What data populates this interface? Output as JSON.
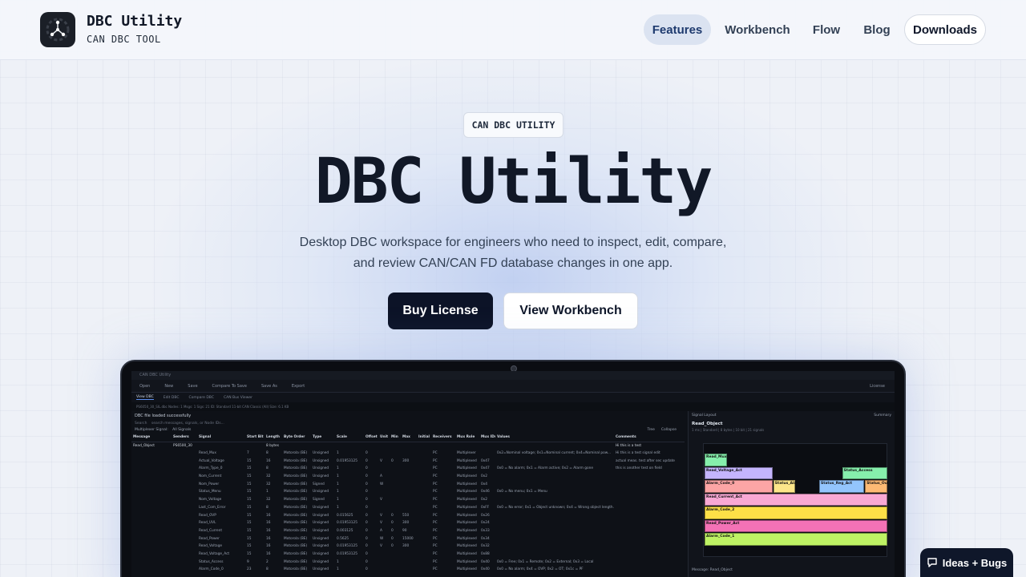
{
  "header": {
    "brand_title": "DBC Utility",
    "brand_subtitle": "CAN DBC TOOL",
    "nav": [
      {
        "label": "Features",
        "active": true
      },
      {
        "label": "Workbench"
      },
      {
        "label": "Flow"
      },
      {
        "label": "Blog"
      },
      {
        "label": "Downloads",
        "outlined": true
      }
    ]
  },
  "hero": {
    "pill": "CAN DBC UTILITY",
    "title": "DBC Utility",
    "description_line1": "Desktop DBC workspace for engineers who need to inspect, edit, compare,",
    "description_line2": "and review CAN/CAN FD database changes in one app.",
    "primary_button": "Buy License",
    "secondary_button": "View Workbench"
  },
  "app": {
    "window_title": "CAN DBC Utility",
    "toolbar": [
      "Open",
      "New",
      "Save",
      "Compare To Save",
      "Save As",
      "Export"
    ],
    "license_label": "License",
    "tabs": [
      "View DBC",
      "Edit DBC",
      "Compare DBC",
      "CAN Bus Viewer"
    ],
    "file_bar": "PS6050_30_SIL.dbc   Nodes: 1   Msgs: 1   Sigs: 21   ID: Standard 11-bit   CAN Classic (All)   Size: 6.1 KB",
    "status": "DBC file loaded successfully",
    "search_label": "Search",
    "search_placeholder": "search messages, signals, or Node IDs...",
    "mux_label": "Multiplexer Signal:",
    "mux_value": "All Signals",
    "tree_label": "Tree",
    "collapse_label": "Collapse",
    "columns": [
      "Message",
      "Senders",
      "Signal",
      "Start Bit",
      "Length",
      "Byte Order",
      "Type",
      "Scale",
      "Offset",
      "Unit",
      "Min",
      "Max",
      "Initial",
      "Receivers",
      "Mux Role",
      "Mux IDs",
      "Values",
      "Comments"
    ],
    "message_row": [
      "Read_Object",
      "PS6500_30",
      "",
      "",
      "8 bytes",
      "",
      "",
      "",
      "",
      "",
      "",
      "",
      "",
      "",
      "",
      "",
      "",
      "Hi this is a test"
    ],
    "rows": [
      [
        "Read_Mux",
        "7",
        "8",
        "Motorola (BE)",
        "Unsigned",
        "1",
        "0",
        "",
        "",
        "",
        "",
        "PC",
        "Multiplexer",
        "",
        "0x2=Nominal voltage; 0x1=Nominal current; 0x4=Nominal pow...",
        "Hi this is a test signal edit"
      ],
      [
        "Actual_Voltage",
        "15",
        "16",
        "Motorola (BE)",
        "Unsigned",
        "0.01953125",
        "0",
        "V",
        "0",
        "300",
        "",
        "PC",
        "Multiplexed",
        "0x47",
        "",
        "actual meas. test after sec update"
      ],
      [
        "Alarm_Type_0",
        "15",
        "8",
        "Motorola (BE)",
        "Unsigned",
        "1",
        "0",
        "",
        "",
        "",
        "",
        "PC",
        "Multiplexed",
        "0x47",
        "0x0 = No alarm; 0x1 = Alarm active; 0x2 = Alarm gone",
        "this is another test on field"
      ],
      [
        "Nom_Current",
        "15",
        "32",
        "Motorola (BE)",
        "Unsigned",
        "1",
        "0",
        "A",
        "",
        "",
        "",
        "PC",
        "Multiplexed",
        "0x2",
        "",
        ""
      ],
      [
        "Nom_Power",
        "15",
        "32",
        "Motorola (BE)",
        "Signed",
        "1",
        "0",
        "W",
        "",
        "",
        "",
        "PC",
        "Multiplexed",
        "0x4",
        "",
        ""
      ],
      [
        "Status_Menu",
        "15",
        "1",
        "Motorola (BE)",
        "Unsigned",
        "1",
        "0",
        "",
        "",
        "",
        "",
        "PC",
        "Multiplexed",
        "0x46",
        "0x0 = No menu; 0x1 = Menu",
        ""
      ],
      [
        "Nom_Voltage",
        "15",
        "32",
        "Motorola (BE)",
        "Signed",
        "1",
        "0",
        "V",
        "",
        "",
        "",
        "PC",
        "Multiplexed",
        "0x2",
        "",
        ""
      ],
      [
        "Last_Com_Error",
        "15",
        "8",
        "Motorola (BE)",
        "Unsigned",
        "1",
        "0",
        "",
        "",
        "",
        "",
        "PC",
        "Multiplexed",
        "0xFF",
        "0x0 = No error; 0x1 = Object unknown; 0x4 = Wrong object length...",
        ""
      ],
      [
        "Read_OVP",
        "15",
        "16",
        "Motorola (BE)",
        "Unsigned",
        "0.015625",
        "0",
        "V",
        "0",
        "550",
        "",
        "PC",
        "Multiplexed",
        "0x26",
        "",
        ""
      ],
      [
        "Read_UVL",
        "15",
        "16",
        "Motorola (BE)",
        "Unsigned",
        "0.01953125",
        "0",
        "V",
        "0",
        "300",
        "",
        "PC",
        "Multiplexed",
        "0x24",
        "",
        ""
      ],
      [
        "Read_Current",
        "15",
        "16",
        "Motorola (BE)",
        "Unsigned",
        "0.003125",
        "0",
        "A",
        "0",
        "90",
        "",
        "PC",
        "Multiplexed",
        "0x33",
        "",
        ""
      ],
      [
        "Read_Power",
        "15",
        "16",
        "Motorola (BE)",
        "Unsigned",
        "0.5625",
        "0",
        "W",
        "0",
        "15000",
        "",
        "PC",
        "Multiplexed",
        "0x34",
        "",
        ""
      ],
      [
        "Read_Voltage",
        "15",
        "16",
        "Motorola (BE)",
        "Unsigned",
        "0.01953125",
        "0",
        "V",
        "0",
        "300",
        "",
        "PC",
        "Multiplexed",
        "0x32",
        "",
        ""
      ],
      [
        "Read_Voltage_Act",
        "15",
        "16",
        "Motorola (BE)",
        "Unsigned",
        "0.01953125",
        "0",
        "",
        "",
        "",
        "",
        "PC",
        "Multiplexed",
        "0x88",
        "",
        ""
      ],
      [
        "Status_Access",
        "9",
        "2",
        "Motorola (BE)",
        "Unsigned",
        "1",
        "0",
        "",
        "",
        "",
        "",
        "PC",
        "Multiplexed",
        "0x40",
        "0x0 = Free; 0x1 = Remote; 0x2 = External; 0x3 = Local",
        ""
      ],
      [
        "Alarm_Code_0",
        "23",
        "8",
        "Motorola (BE)",
        "Unsigned",
        "1",
        "0",
        "",
        "",
        "",
        "",
        "PC",
        "Multiplexed",
        "0x40",
        "0x0 = No alarm; 0x4 = OVP; 0x2 = OT; 0x1c = PF",
        ""
      ]
    ],
    "layout_panel": {
      "header": "Signal Layout",
      "summary_button": "Summary",
      "message": "Read_Object",
      "meta": "1 ms | Standard | 8 bytes | 10 bit | 21 signals",
      "blocks": [
        {
          "label": "Read_Mux",
          "color": "#86efac"
        },
        {
          "label": "Read_Voltage_Act",
          "color": "#c4b5fd"
        },
        {
          "label": "Status_Access",
          "color": "#86efac"
        },
        {
          "label": "Alarm_Code_0",
          "color": "#fca5a5"
        },
        {
          "label": "Status_Ala",
          "color": "#fde68a"
        },
        {
          "label": "Status_Reg_Act",
          "color": "#93c5fd"
        },
        {
          "label": "Status_Out",
          "color": "#fdba74"
        },
        {
          "label": "Read_Current_Act",
          "color": "#f9a8d4"
        },
        {
          "label": "Alarm_Code_2",
          "color": "#fde047"
        },
        {
          "label": "Read_Power_Act",
          "color": "#f472b6"
        },
        {
          "label": "Alarm_Code_1",
          "color": "#bef264"
        }
      ],
      "footer": "Message: Read_Object"
    }
  },
  "feedback": {
    "label": "Ideas + Bugs"
  }
}
